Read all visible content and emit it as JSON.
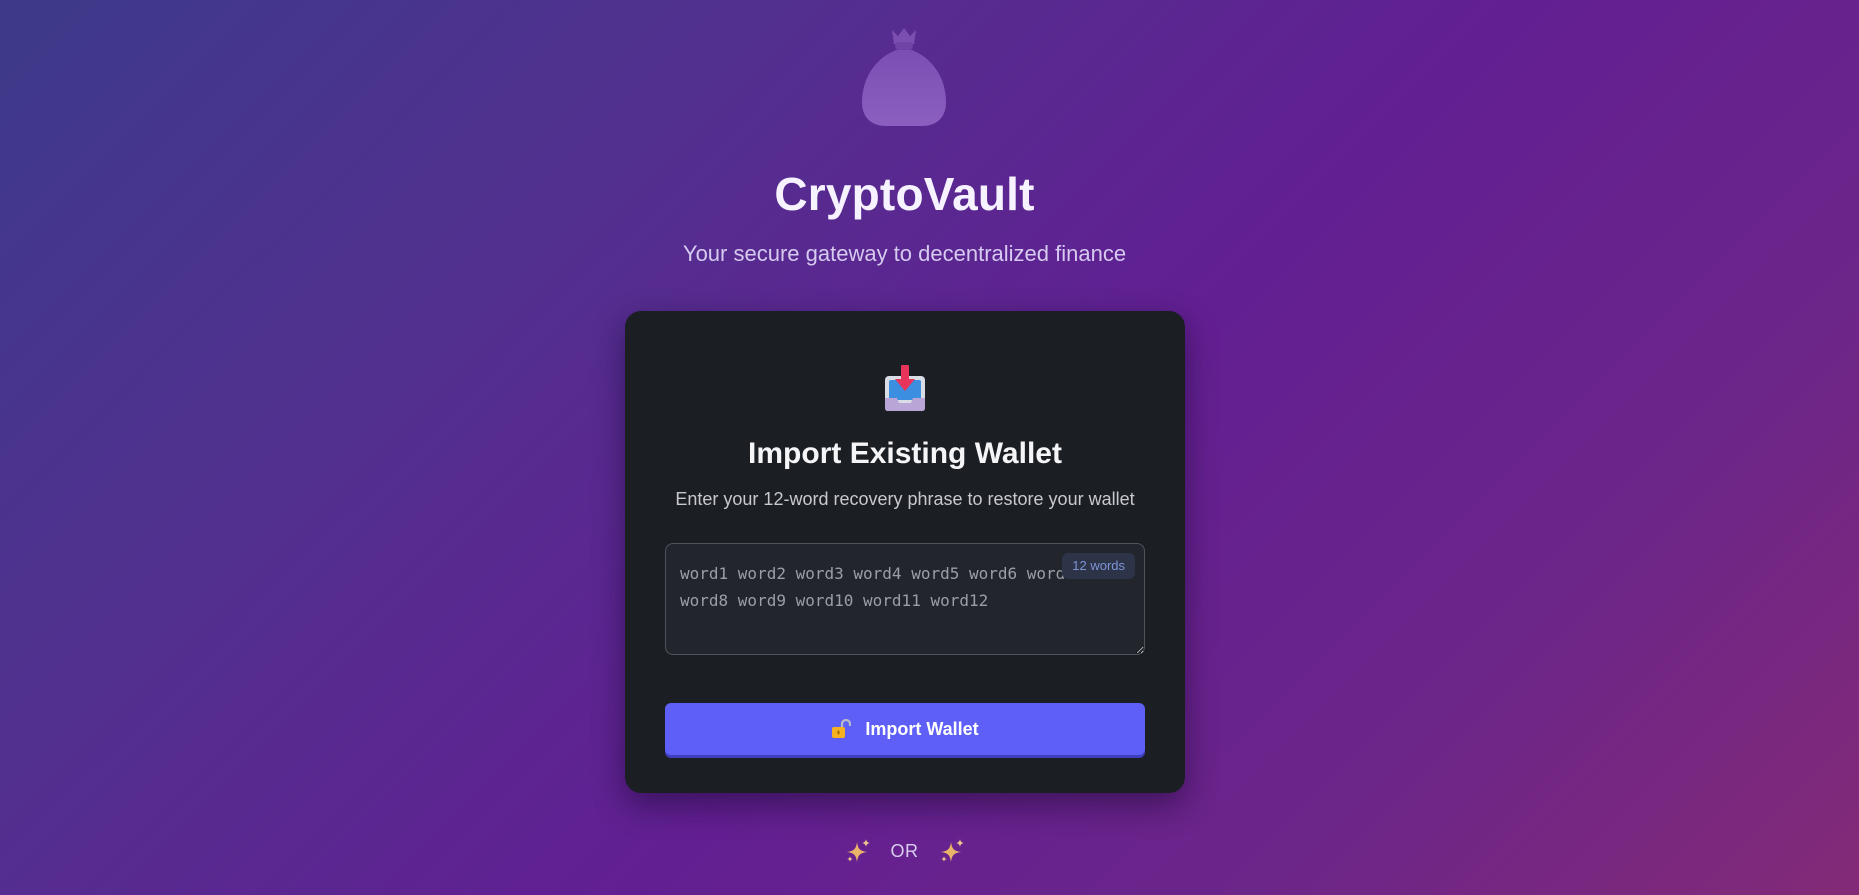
{
  "app": {
    "title": "CryptoVault",
    "subtitle": "Your secure gateway to decentralized finance",
    "logo_icon": "money-bag-icon"
  },
  "import_card": {
    "icon": "inbox-tray-icon",
    "title": "Import Existing Wallet",
    "description": "Enter your 12-word recovery phrase to restore your wallet",
    "phrase_placeholder": "word1 word2 word3 word4 word5 word6 word7 word8 word9 word10 word11 word12",
    "phrase_value": "",
    "word_count_badge": "12 words",
    "button_label": "Import Wallet",
    "button_icon": "unlocked-lock-icon"
  },
  "divider": {
    "label": "OR",
    "icon": "sparkles-icon"
  },
  "colors": {
    "accent": "#5e5ff7",
    "card_bg": "#1b1e23",
    "badge_text": "#7f93d8"
  }
}
